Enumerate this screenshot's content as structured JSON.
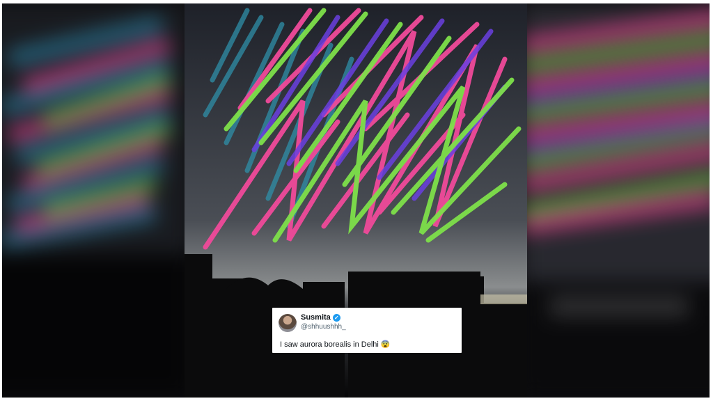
{
  "tweet": {
    "author_name": "Susmita",
    "author_handle": "@shhuushhh_",
    "verified_icon": "verified-badge-icon",
    "text": "I saw aurora borealis in Delhi",
    "emoji": "😨"
  },
  "colors": {
    "pink": "#f04a9a",
    "green": "#7ee04a",
    "purple": "#6a3fe0",
    "teal": "#2f8fa8",
    "verified_blue": "#1d9bf0"
  }
}
